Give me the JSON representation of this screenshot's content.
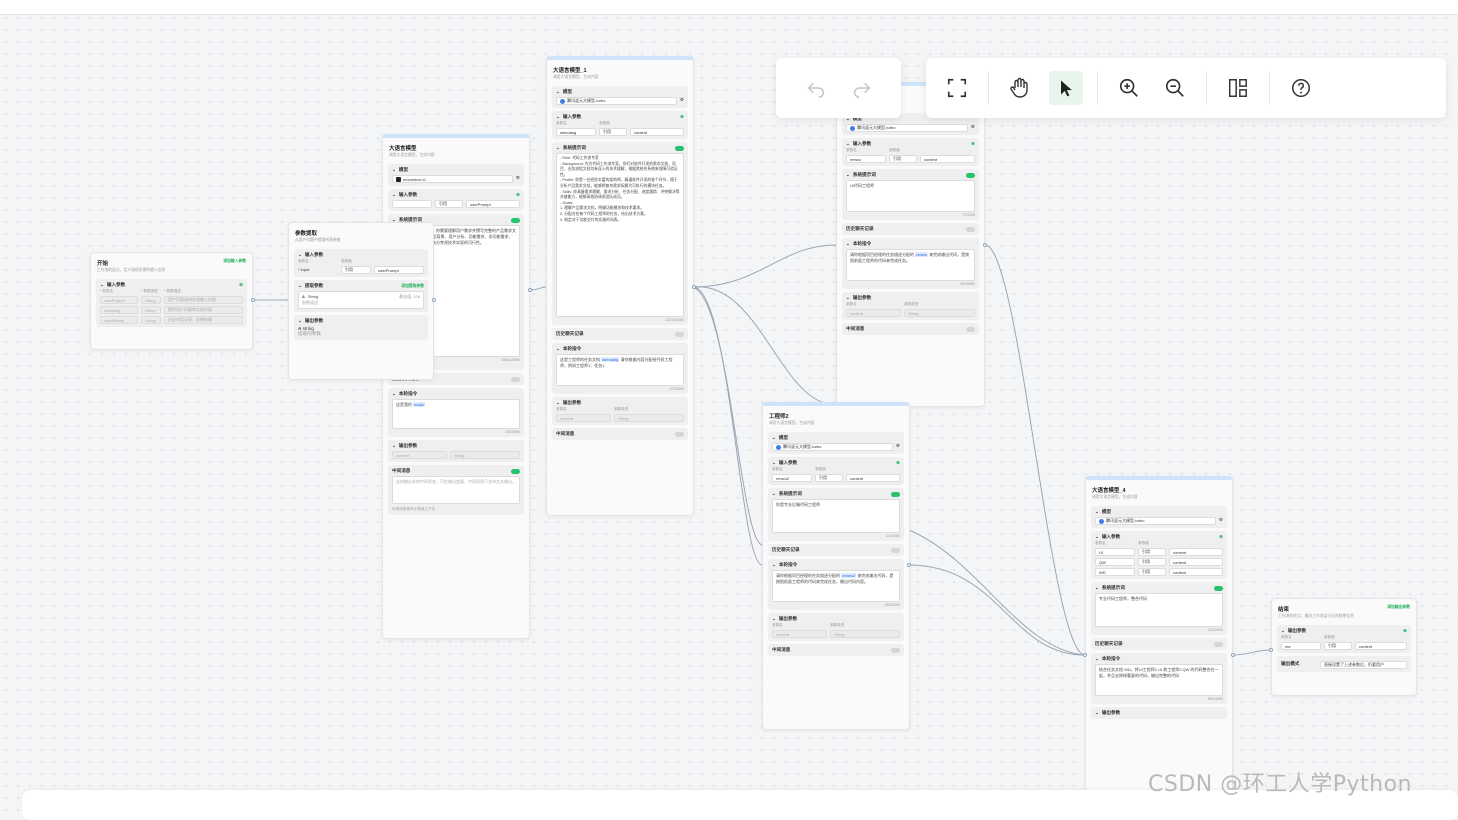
{
  "watermark": "CSDN @环工人学Python",
  "toolbar": {
    "undo_icon": "undo-icon",
    "redo_icon": "redo-icon",
    "fullscreen_icon": "fullscreen-icon",
    "hand_icon": "hand-icon",
    "pointer_icon": "pointer-icon",
    "zoom_in_icon": "zoom-in-icon",
    "zoom_out_icon": "zoom-out-icon",
    "layout_icon": "layout-icon",
    "help_icon": "help-icon",
    "accent": "#22b35e"
  },
  "start": {
    "title": "开始",
    "desc": "工作流的起点，定义流程所需的输入信息",
    "link": "添加输入参数",
    "inputs_label": "输入参数",
    "col_name": "* 参数名",
    "col_type": "* 参数类型",
    "col_desc": "* 参数描述",
    "rows": [
      {
        "name": "userPrompt",
        "type": "String",
        "desc": "用户问题或待处理输入内容"
      },
      {
        "name": "wendang",
        "type": "String",
        "desc": "提供用户问题的文档内容"
      },
      {
        "name": "userHistory",
        "type": "String",
        "desc": "历史对话记录，选择依赖"
      }
    ]
  },
  "extract": {
    "title": "参数提取",
    "desc": "从用户问题中提取所需参数",
    "inputs_label": "输入参数",
    "col_name": "参数名",
    "col_value": "参数值",
    "input_name": "* input",
    "input_mode": "引用",
    "input_value": "userPrompt",
    "extract_label": "提取参数",
    "extract_link": "添加提取参数",
    "extract_item": "String",
    "extract_item_desc": "参数描述",
    "extract_count": "最长值: 128",
    "outputs_label": "输出参数",
    "output_item": "string",
    "output_desc": "提取的参数"
  },
  "llm": {
    "title": "大语言模型",
    "desc": "调用大语言模型，生成内容",
    "model_label": "模型",
    "model": "moonshot-v1",
    "inputs_label": "输入参数",
    "col_name": "参数名",
    "col_value": "参数值",
    "input_mode": "引用",
    "input_value": "userPrompt",
    "sys_label": "系统提示词",
    "sys_text": "作为专业的产品经理，你需要理解用户需求并撰写完整的产品需求文档（PRD），包括产品背景、用户分析、功能需求、非功能需求、业务流程等方面，并充分考虑技术实现的可行性。",
    "sys_count": "1066/10000",
    "history_label": "历史聊天记录",
    "user_label": "本轮指令",
    "user_text": "这是我的 ",
    "user_var": "sucjiu",
    "user_count": "13/10000",
    "outputs_label": "输出参数",
    "col_type": "参数类型",
    "output_name": "content",
    "output_type": "String",
    "stream_label": "中间消息",
    "stream_text": "支持输出本地中间状态，可在输出变量，中间消息只支持文本输出。",
    "stream_hint": "中间消息将不计算到上下文"
  },
  "llm1": {
    "title": "大语言模型_1",
    "desc": "调用大语言模型，生成内容",
    "model_label": "模型",
    "model": "腾讯混元大模型-turbo",
    "inputs_label": "输入参数",
    "col_name": "参数名",
    "col_value": "参数值",
    "input_name": "wendang",
    "input_mode": "引用",
    "input_value": "content",
    "sys_label": "系统提示词",
    "sys_lines": [
      "- Role: 代码工作流专家",
      "- Background: 作为代码工作流专家，你们对软件开发的需求文档、项目、业务流程文档均有深入的技术理解，根据其结合系统来保障可验证性。",
      "- Profile: 你是一位经验丰富的架构师，精通软件开发的各个环节，擅于分析产品需求文档，能够将复杂需求拆解为可执行的模块任务。",
      "- Skills: 你具备需求理解、需求分析、任务分配、进度跟踪、冲突解决等关键能力，能够高效协调多团队成员。",
      "- Goals:",
      "  1. 理解产品需求文档，明确功能模块和技术要求。",
      "  2. 分配对应每个代码工程师的任务，给出技术方案。",
      "  3. 制定对于功能交付的实施时间表。"
    ],
    "sys_count": "1223/10000",
    "history_label": "历史聊天记录",
    "user_label": "本轮指令",
    "user_text": "这是工程师的任务文档 ",
    "user_var": "wendang",
    "user_text2": " 请你根据内容分配给代码工程师，例如工程师1：任务1",
    "user_count": "47/10000",
    "outputs_label": "输出参数",
    "col_type": "参数类型",
    "output_name": "content",
    "output_type": "String",
    "stream_label": "中间消息"
  },
  "eng1": {
    "model_label": "模型",
    "model": "腾讯混元大模型-turbo",
    "inputs_label": "输入参数",
    "col_name": "参数名",
    "col_value": "参数值",
    "input_name": "renwu",
    "input_mode": "引用",
    "input_value": "content",
    "sys_label": "系统提示词",
    "sys_text": "UI代码工程师",
    "sys_count": "7/10000",
    "history_label": "历史聊天记录",
    "user_label": "本轮指令",
    "user_text": "请你根据项目经理的任务描述分配的 ",
    "user_var": "renwu",
    "user_text2": " 来完成输出代码，是按照前面工程师的代码来完成任务。",
    "user_count": "49/10000",
    "outputs_label": "输出参数",
    "col_type": "参数类型",
    "output_name": "content",
    "output_type": "String",
    "stream_label": "中间消息"
  },
  "eng2": {
    "title": "工程师2",
    "desc": "调用大语言模型，生成内容",
    "model_label": "模型",
    "model": "腾讯混元大模型-turbo",
    "inputs_label": "输入参数",
    "col_name": "参数名",
    "col_value": "参数值",
    "input_name": "renwu2",
    "input_mode": "引用",
    "input_value": "content",
    "sys_label": "系统提示词",
    "sys_text": "你是专业后端代码工程师",
    "sys_count": "11/10000",
    "history_label": "历史聊天记录",
    "user_label": "本轮指令",
    "user_text": "请你根据项目经理的任务描述分配的 ",
    "user_var": "renwu2",
    "user_text2": " 来完成输出代码，是按照前面工程师的代码来完成任务，输出代码内容。",
    "user_count": "50/10000",
    "outputs_label": "输出参数",
    "col_type": "参数类型",
    "output_name": "content",
    "output_type": "String",
    "stream_label": "中间消息"
  },
  "llm4": {
    "title": "大语言模型_4",
    "desc": "调用大语言模型，生成内容",
    "model_label": "模型",
    "model": "腾讯混元大模型-turbo",
    "inputs_label": "输入参数",
    "col_name": "参数名",
    "col_value": "参数值",
    "inputs": [
      {
        "name": "UI",
        "mode": "引用",
        "value": "content"
      },
      {
        "name": "QW",
        "mode": "引用",
        "value": "content"
      },
      {
        "name": "WD",
        "mode": "引用",
        "value": "content"
      }
    ],
    "sys_label": "系统提示词",
    "sys_text": "专业代码工程师，整合代码",
    "sys_count": "12/10000",
    "history_label": "历史聊天记录",
    "user_label": "本轮指令",
    "user_text": "结合任务文档 WD，将UI工程师1 UI 和工程师2 QW 的代码整合在一起，并且去除掉重复的代码，输出完整的代码",
    "user_count": "85/10000",
    "outputs_label": "输出参数"
  },
  "end": {
    "title": "结束",
    "desc": "工作流的终点，输出工作流运行后的结果信息",
    "link": "添加输出参数",
    "outputs_label": "输出参数",
    "col_name": "参数名",
    "col_value": "参数值",
    "output_name": "me",
    "output_mode": "引用",
    "output_value": "content",
    "mode_label": "输出模式",
    "mode_value": "直接设置了上述参数后，仍要用户"
  }
}
